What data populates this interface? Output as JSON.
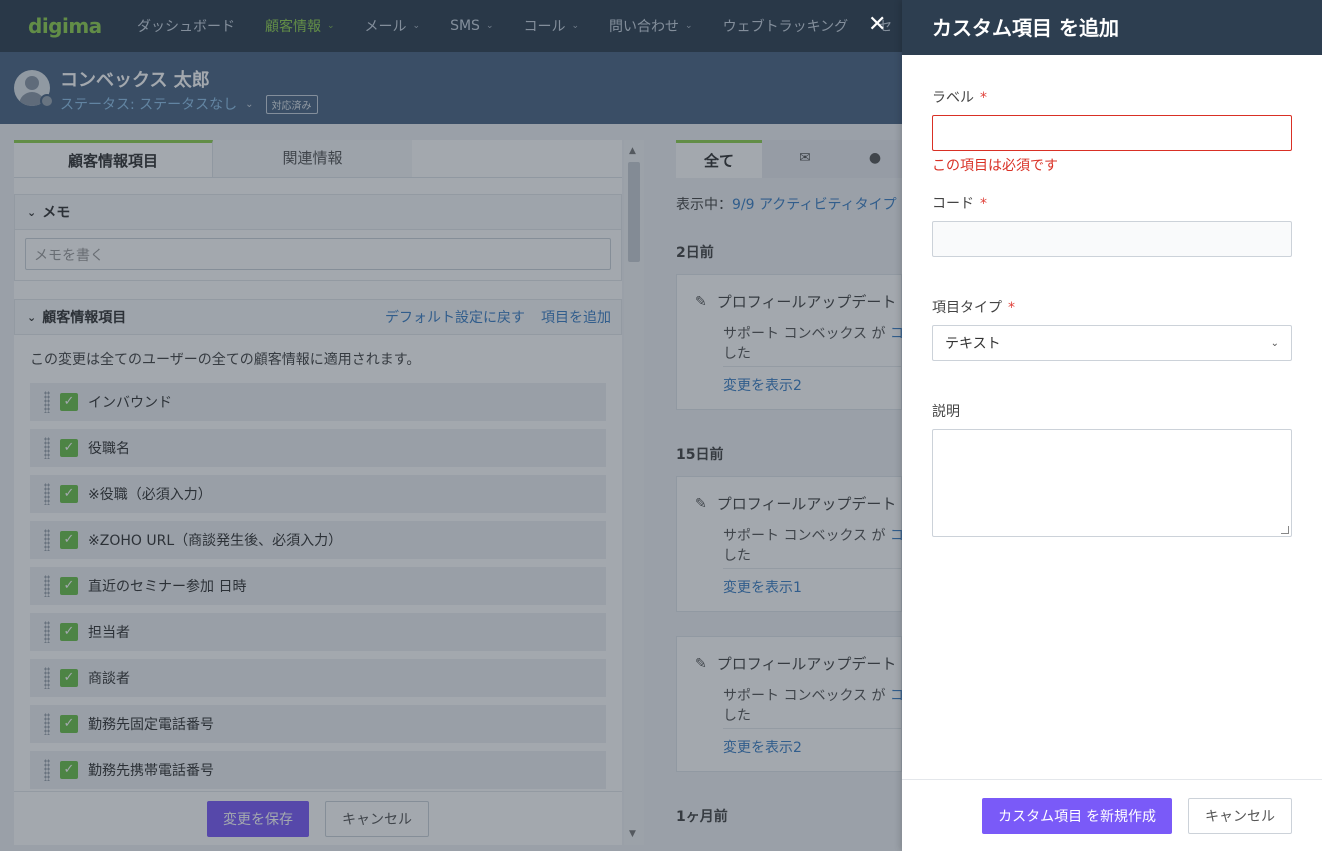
{
  "nav": {
    "logo": "digima",
    "items": [
      {
        "label": "ダッシュボード",
        "chevron": false,
        "active": false
      },
      {
        "label": "顧客情報",
        "chevron": true,
        "active": true
      },
      {
        "label": "メール",
        "chevron": true,
        "active": false
      },
      {
        "label": "SMS",
        "chevron": true,
        "active": false
      },
      {
        "label": "コール",
        "chevron": true,
        "active": false
      },
      {
        "label": "問い合わせ",
        "chevron": true,
        "active": false
      },
      {
        "label": "ウェブトラッキング",
        "chevron": false,
        "active": false
      },
      {
        "label": "セ",
        "chevron": false,
        "active": false
      }
    ]
  },
  "header": {
    "name": "コンベックス 太郎",
    "status": "ステータス: ステータスなし",
    "badge": "対応済み"
  },
  "left": {
    "tabs": [
      "顧客情報項目",
      "関連情報"
    ],
    "memo": {
      "title": "メモ",
      "placeholder": "メモを書く"
    },
    "fields_section": {
      "title": "顧客情報項目",
      "reset_link": "デフォルト設定に戻す",
      "add_link": "項目を追加",
      "notice": "この変更は全てのユーザーの全ての顧客情報に適用されます。",
      "items": [
        "インバウンド",
        "役職名",
        "※役職（必須入力）",
        "※ZOHO URL（商談発生後、必須入力）",
        "直近のセミナー参加 日時",
        "担当者",
        "商談者",
        "勤務先固定電話番号",
        "勤務先携帯電話番号"
      ]
    },
    "save_label": "変更を保存",
    "cancel_label": "キャンセル"
  },
  "activity": {
    "tabs": [
      "全て"
    ],
    "showing_prefix": "表示中：",
    "showing_value": "9/9 アクティビティタイプ",
    "groups": [
      {
        "label": "2日前",
        "title": "プロフィールアップデート",
        "text_prefix": "サポート コンベックス が",
        "text_link": "コ",
        "text_line2": "した",
        "link": "変更を表示2"
      },
      {
        "label": "15日前",
        "title": "プロフィールアップデート",
        "text_prefix": "サポート コンベックス が",
        "text_link": "コ",
        "text_line2": "した",
        "link": "変更を表示1"
      },
      {
        "label": "",
        "title": "プロフィールアップデート",
        "text_prefix": "サポート コンベックス が",
        "text_link": "コ",
        "text_line2": "した",
        "link": "変更を表示2"
      }
    ],
    "last_group": "1ヶ月前"
  },
  "drawer": {
    "title": "カスタム項目 を追加",
    "label_field": {
      "label": "ラベル",
      "required_mark": "*",
      "error": "この項目は必須です"
    },
    "code_field": {
      "label": "コード",
      "required_mark": "*"
    },
    "type_field": {
      "label": "項目タイプ",
      "required_mark": "*",
      "value": "テキスト"
    },
    "desc_field": {
      "label": "説明"
    },
    "create_label": "カスタム項目 を新規作成",
    "cancel_label": "キャンセル"
  }
}
